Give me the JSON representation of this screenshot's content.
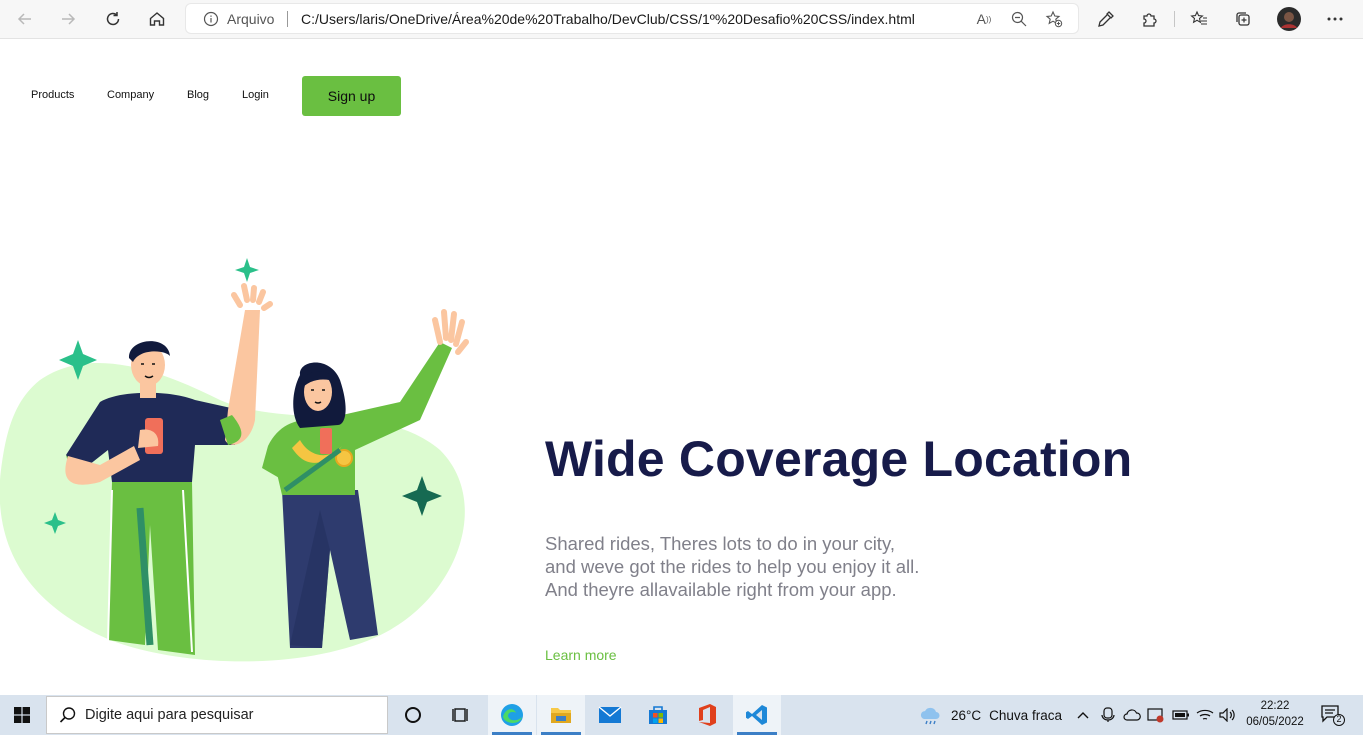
{
  "browser": {
    "address_prefix": "Arquivo",
    "url": "C:/Users/laris/OneDrive/Área%20de%20Trabalho/DevClub/CSS/1º%20Desafio%20CSS/index.html",
    "read_aloud_label": "A",
    "icons": [
      "back-icon",
      "forward-icon",
      "refresh-icon",
      "home-icon",
      "info-icon",
      "read-aloud-icon",
      "zoom-out-icon",
      "add-favorite-icon",
      "eyedropper-icon",
      "extensions-icon",
      "favorites-icon",
      "collections-icon",
      "profile-avatar",
      "more-icon"
    ]
  },
  "nav": {
    "links": [
      "Products",
      "Company",
      "Blog",
      "Login"
    ],
    "signup_label": "Sign up"
  },
  "hero": {
    "headline": "Wide Coverage Location",
    "description_lines": [
      "Shared rides, Theres lots to do in your city,",
      "and weve got the rides to help you enjoy it all.",
      "And theyre allavailable right from your app."
    ],
    "cta": "Learn more"
  },
  "colors": {
    "accent_green": "#6abf41",
    "headline_navy": "#171b4a",
    "body_gray": "#80808a",
    "blob_green": "#dcfbd0"
  },
  "taskbar": {
    "search_placeholder": "Digite aqui para pesquisar",
    "weather_temp": "26°C",
    "weather_text": "Chuva fraca",
    "time": "22:22",
    "date": "06/05/2022",
    "notification_count": "2",
    "apps": [
      "cortana-icon",
      "task-view-icon",
      "edge-icon",
      "file-explorer-icon",
      "mail-icon",
      "store-icon",
      "office-icon",
      "vscode-icon"
    ]
  }
}
